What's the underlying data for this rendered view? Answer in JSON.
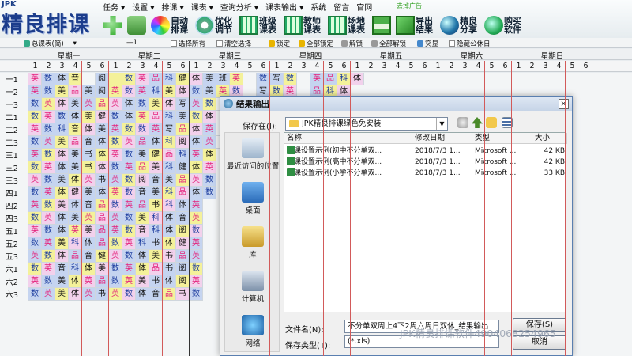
{
  "app": {
    "logo_small": "JPK",
    "logo": "精良排课"
  },
  "menu": [
    "任务",
    "设置",
    "排课",
    "课表",
    "查询分析",
    "课表输出",
    "系统",
    "留言",
    "官网"
  ],
  "badge": "去掉广告",
  "toolbar": [
    {
      "label": "",
      "icon": "add-icon"
    },
    {
      "label": "",
      "icon": "import-icon"
    },
    {
      "label": "自动排课",
      "icon": "color-wheel-icon"
    },
    {
      "label": "优化调节",
      "icon": "gear-icon"
    },
    {
      "label": "班级课表",
      "icon": "grid-icon"
    },
    {
      "label": "教师课表",
      "icon": "grid-icon"
    },
    {
      "label": "场地课表",
      "icon": "grid-icon"
    },
    {
      "label": "",
      "icon": "save-icon"
    },
    {
      "label": "导出结果",
      "icon": "export-icon"
    },
    {
      "label": "精良分享",
      "icon": "globe-icon"
    },
    {
      "label": "购买软件",
      "icon": "buy-icon"
    }
  ],
  "subbar": {
    "view": "总课表(简)",
    "sep": "—1",
    "select_all": "选择所有",
    "clear_select": "清空选择",
    "lock": "锁定",
    "lock_all": "全部锁定",
    "unlock": "解锁",
    "unlock_all": "全部解锁",
    "conflict": "突显",
    "hide_holiday": "隐藏公休日"
  },
  "days": [
    "星期一",
    "星期二",
    "星期三",
    "星期四",
    "星期五",
    "星期六",
    "星期日"
  ],
  "periods": [
    "1",
    "2",
    "3",
    "4",
    "5",
    "6"
  ],
  "rows": [
    "一1",
    "一2",
    "一3",
    "二1",
    "二2",
    "二3",
    "三1",
    "三2",
    "三3",
    "四1",
    "四2",
    "四3",
    "五1",
    "五2",
    "五3",
    "六1",
    "六2",
    "六3"
  ],
  "schedule": [
    "英数体音 阅 数英品科健体美班英 数写数 英品科体",
    "英数美品美阅英数英科美体数美英数 写数英 品科体",
    "数英体美英品英体数美体写英数 美品体 科数",
    "数英数体美健数体英品科美数体 英美体数",
    "英数科音体美英数数英写品体英 数科 美",
    "数英美品音体数英品体科阅体英 数 美品",
    "英数体美书体英数美健品科英体 数 英",
    "数英体美书体数英品美科健体英",
    "英数美体英书英数阅音美品英数",
    "数英体健美体英数音美科品体数",
    "英数美体音品数英品书科体英",
    "数英体美英品英数美科体音英",
    "英数体英美品英数音科体阅数",
    "数英美科体品数英科书体健英",
    "英数体品音健英数体美书品英",
    "数英音科体美数英体品书阅数",
    "英数美体英品数英美书体阅英",
    "数英美体英书英数体音品书数"
  ],
  "dialog": {
    "title": "结果输出",
    "close": "×",
    "save_in_label": "保存在(I):",
    "save_in": "JPK精良排课绿色免安装",
    "places": [
      "最近访问的位置",
      "桌面",
      "库",
      "计算机",
      "网络"
    ],
    "columns": [
      "名称",
      "修改日期",
      "类型",
      "大小"
    ],
    "files": [
      {
        "name": "排课设置示例(初中不分单双...",
        "date": "2018/7/3 1...",
        "type": "Microsoft ...",
        "size": "42 KB"
      },
      {
        "name": "排课设置示例(高中不分单双...",
        "date": "2018/7/3 1...",
        "type": "Microsoft ...",
        "size": "42 KB"
      },
      {
        "name": "排课设置示例(小学不分单双...",
        "date": "2018/7/3 1...",
        "type": "Microsoft ...",
        "size": "33 KB"
      }
    ],
    "filename_label": "文件名(N):",
    "filename": "不分单双周上4下2周六周日双休_结果输出",
    "filetype_label": "保存类型(T):",
    "filetype": "(*.xls)",
    "save_button": "保存(S)",
    "cancel_button": "取消"
  },
  "watermark": "JPK精良排课软件4904068254965",
  "colors": {
    "english": "#e51f7a",
    "math": "#1c3c9e",
    "music": "#111111",
    "cell_blue": "#c5d4f0",
    "cell_pink": "#f2d1ec",
    "cell_yellow": "#f4f19a",
    "period_line": "#d25a5a"
  }
}
